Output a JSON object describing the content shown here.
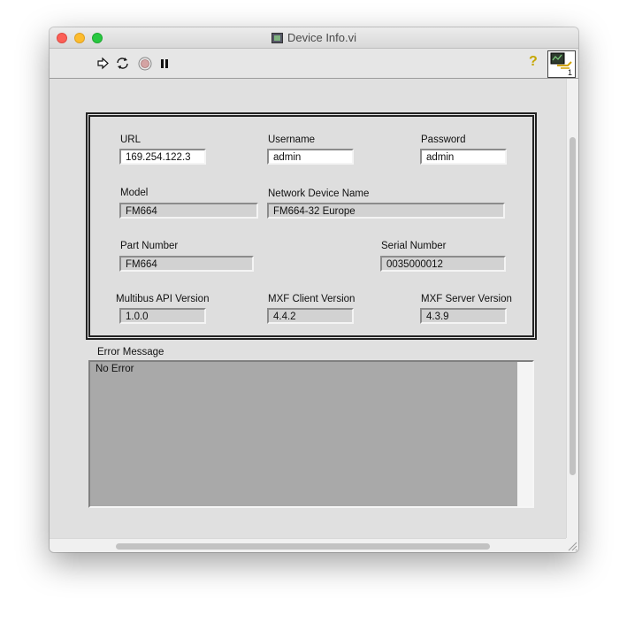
{
  "window": {
    "title": "Device Info.vi"
  },
  "toolbar": {
    "run_icon": "run-arrow-icon",
    "continuous_run_icon": "continuous-run-icon",
    "abort_icon": "abort-stop-icon",
    "pause_icon": "pause-icon",
    "help_label": "?",
    "connector_badge": "1"
  },
  "fields": {
    "url": {
      "label": "URL",
      "value": "169.254.122.3"
    },
    "username": {
      "label": "Username",
      "value": "admin"
    },
    "password": {
      "label": "Password",
      "value": "admin"
    },
    "model": {
      "label": "Model",
      "value": "FM664"
    },
    "network_device_name": {
      "label": "Network Device Name",
      "value": "FM664-32 Europe"
    },
    "part_number": {
      "label": "Part Number",
      "value": "FM664"
    },
    "serial_number": {
      "label": "Serial Number",
      "value": "0035000012"
    },
    "multibus_api_version": {
      "label": "Multibus API Version",
      "value": "1.0.0"
    },
    "mxf_client_version": {
      "label": "MXF Client Version",
      "value": "4.4.2"
    },
    "mxf_server_version": {
      "label": "MXF Server Version",
      "value": "4.3.9"
    }
  },
  "error": {
    "label": "Error Message",
    "value": "No Error"
  },
  "colors": {
    "panel": "#e0e0e0",
    "error_bg": "#a9a9a9",
    "control_bg": "#ffffff",
    "indicator_bg": "#d2d2d2"
  }
}
